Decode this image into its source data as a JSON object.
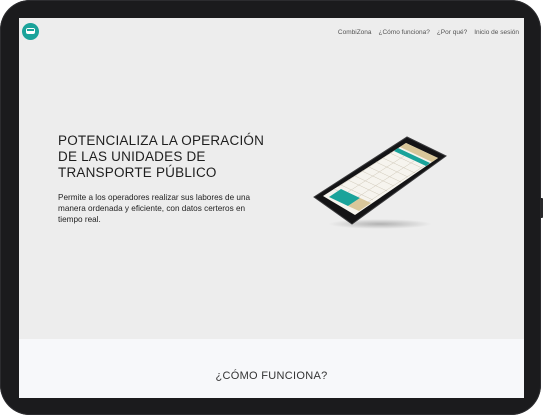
{
  "nav": {
    "logo_icon": "bus-icon",
    "links": [
      "CombiZona",
      "¿Cómo funciona?",
      "¿Por qué?",
      "Inicio de sesión"
    ]
  },
  "hero": {
    "title_lines": [
      "POTENCIALIZA LA OPERACIÓN",
      "DE LAS UNIDADES DE",
      "TRANSPORTE PÚBLICO"
    ],
    "description": "Permite a los operadores realizar sus labores de una manera ordenada y eficiente, con datos certeros en tiempo real."
  },
  "section": {
    "heading": "¿CÓMO FUNCIONA?"
  },
  "colors": {
    "accent": "#1aa39a",
    "background": "#ededed",
    "phone_screen_header": "#d9c79a"
  }
}
